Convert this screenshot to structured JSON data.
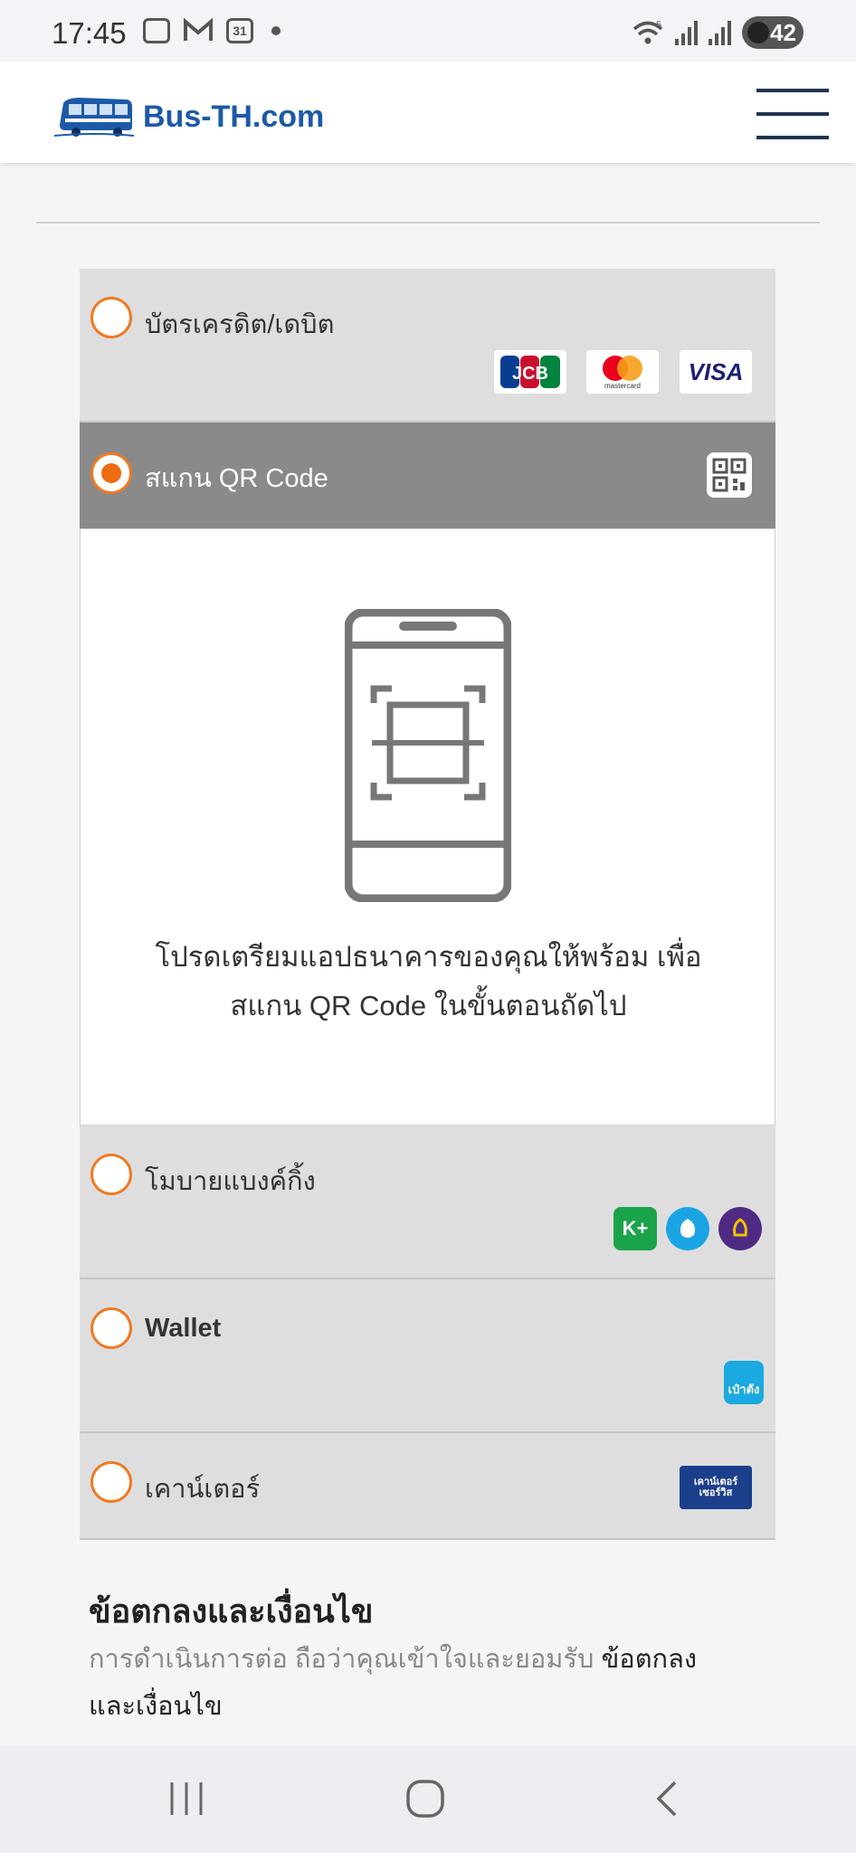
{
  "status_bar": {
    "time": "17:45",
    "calendar_day": "31",
    "battery": "42",
    "network": "5"
  },
  "header": {
    "logo_text": "Bus-TH.com"
  },
  "payment_options": {
    "card": {
      "label": "บัตรเครดิต/เดบิต",
      "brands": [
        "JCB",
        "mastercard",
        "VISA"
      ]
    },
    "qr": {
      "label": "สแกน QR Code",
      "instruction_line1": "โปรดเตรียมแอปธนาคารของคุณให้พร้อม เพื่อ",
      "instruction_line2": "สแกน QR Code ในขั้นตอนถัดไป"
    },
    "mobile_banking": {
      "label": "โมบายแบงค์กิ้ง",
      "brands": [
        "K+"
      ]
    },
    "wallet": {
      "label": "Wallet",
      "brands": [
        "เป๋าตัง"
      ]
    },
    "counter": {
      "label": "เคาน์เตอร์",
      "brands": [
        "เคาน์เตอร์เซอร์วิส"
      ]
    }
  },
  "terms": {
    "title": "ข้อตกลงและเงื่อนไข",
    "body": "การดำเนินการต่อ ถือว่าคุณเข้าใจและยอมรับ ",
    "link": "ข้อตกลงและเงื่อนไข"
  },
  "colors": {
    "accent": "#ef6b10",
    "brand_blue": "#1c5aa8",
    "selected_bg": "#8a8a8a",
    "option_bg": "#dedede"
  }
}
